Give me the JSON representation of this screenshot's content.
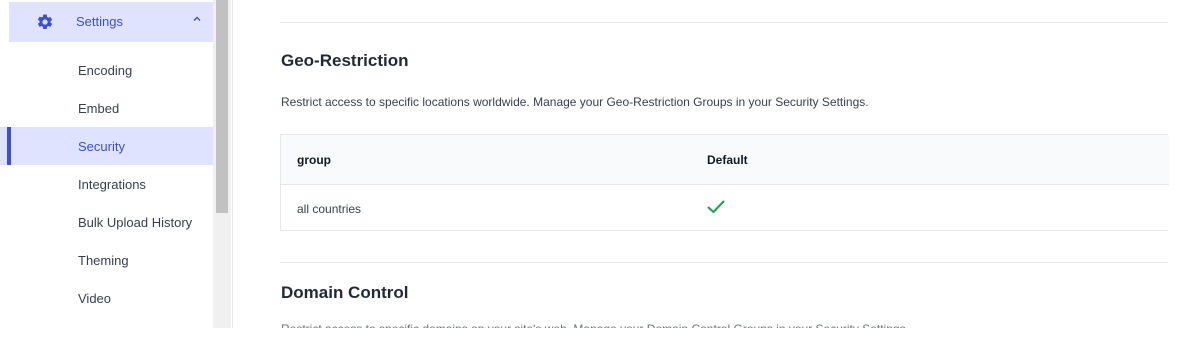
{
  "sidebar": {
    "group": {
      "label": "Settings",
      "icon": "gear-icon",
      "expanded_icon": "chevron-up-icon"
    },
    "items": [
      {
        "label": "Encoding",
        "active": false
      },
      {
        "label": "Embed",
        "active": false
      },
      {
        "label": "Security",
        "active": true
      },
      {
        "label": "Integrations",
        "active": false
      },
      {
        "label": "Bulk Upload History",
        "active": false
      },
      {
        "label": "Theming",
        "active": false
      },
      {
        "label": "Video",
        "active": false
      }
    ]
  },
  "main": {
    "geo": {
      "title": "Geo-Restriction",
      "description": "Restrict access to specific locations worldwide. Manage your Geo-Restriction Groups in your Security Settings.",
      "table": {
        "columns": [
          "group",
          "Default"
        ],
        "rows": [
          {
            "group": "all countries",
            "default": true
          }
        ]
      }
    },
    "domain": {
      "title": "Domain Control",
      "description": "Restrict access to specific domains on your site's web. Manage your Domain Control Groups in your Security Settings."
    }
  },
  "colors": {
    "accent": "#3b4ed6",
    "active_bg": "#dfe3ff",
    "check": "#16a34a"
  }
}
